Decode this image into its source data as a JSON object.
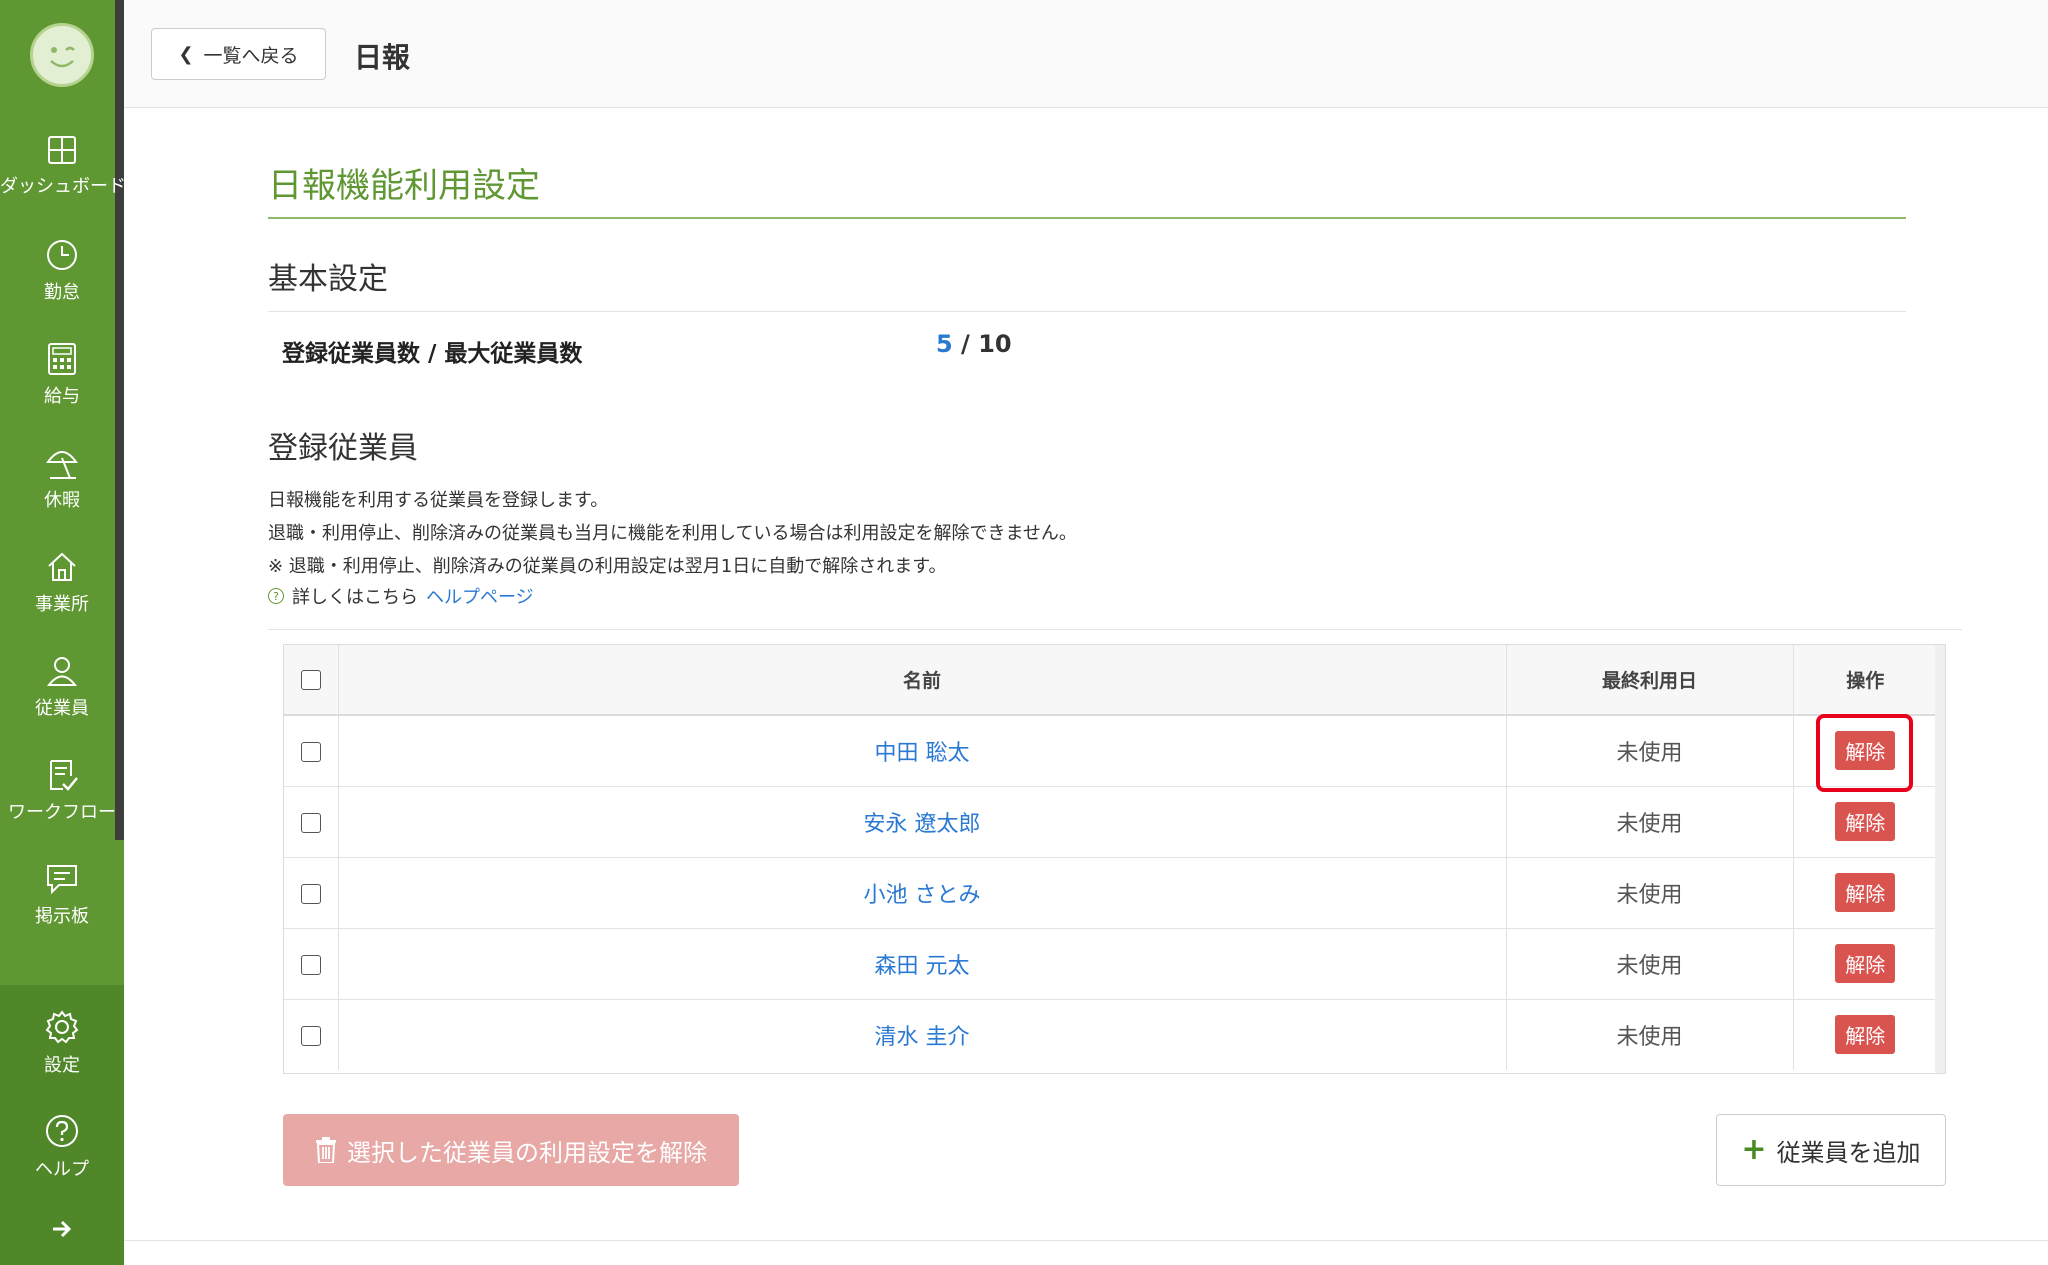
{
  "sidebar": {
    "items": [
      {
        "label": "ダッシュボード",
        "icon": "dashboard-icon"
      },
      {
        "label": "勤怠",
        "icon": "clock-icon"
      },
      {
        "label": "給与",
        "icon": "calculator-icon"
      },
      {
        "label": "休暇",
        "icon": "parasol-icon"
      },
      {
        "label": "事業所",
        "icon": "home-icon"
      },
      {
        "label": "従業員",
        "icon": "person-icon"
      },
      {
        "label": "ワークフロー",
        "icon": "document-check-icon"
      },
      {
        "label": "掲示板",
        "icon": "chat-icon"
      }
    ],
    "bottom": [
      {
        "label": "設定",
        "icon": "gear-icon"
      },
      {
        "label": "ヘルプ",
        "icon": "help-icon"
      }
    ],
    "brand_color": "#5f9732"
  },
  "header": {
    "back_label": "一覧へ戻る",
    "title": "日報"
  },
  "main": {
    "page_title": "日報機能利用設定",
    "basic_title": "基本設定",
    "count_label": "登録従業員数 / 最大従業員数",
    "count_current": "5",
    "count_separator": " / ",
    "count_max": "10",
    "registered_title": "登録従業員",
    "desc1": "日報機能を利用する従業員を登録します。",
    "desc2": "退職・利用停止、削除済みの従業員も当月に機能を利用している場合は利用設定を解除できません。",
    "desc3": "※ 退職・利用停止、削除済みの従業員の利用設定は翌月1日に自動で解除されます。",
    "help_prefix": "詳しくはこちら",
    "help_link": "ヘルプページ"
  },
  "table": {
    "headers": {
      "name": "名前",
      "last_used": "最終利用日",
      "action": "操作"
    },
    "rows": [
      {
        "name": "中田 聡太",
        "last_used": "未使用",
        "action": "解除"
      },
      {
        "name": "安永 遼太郎",
        "last_used": "未使用",
        "action": "解除"
      },
      {
        "name": "小池 さとみ",
        "last_used": "未使用",
        "action": "解除"
      },
      {
        "name": "森田 元太",
        "last_used": "未使用",
        "action": "解除"
      },
      {
        "name": "清水 圭介",
        "last_used": "未使用",
        "action": "解除"
      }
    ]
  },
  "buttons": {
    "bulk_remove": "選択した従業員の利用設定を解除",
    "add_employee": "従業員を追加"
  },
  "colors": {
    "accent": "#5f9732",
    "link": "#2a79d2",
    "danger": "#d9534f",
    "highlight": "#e8001c"
  }
}
